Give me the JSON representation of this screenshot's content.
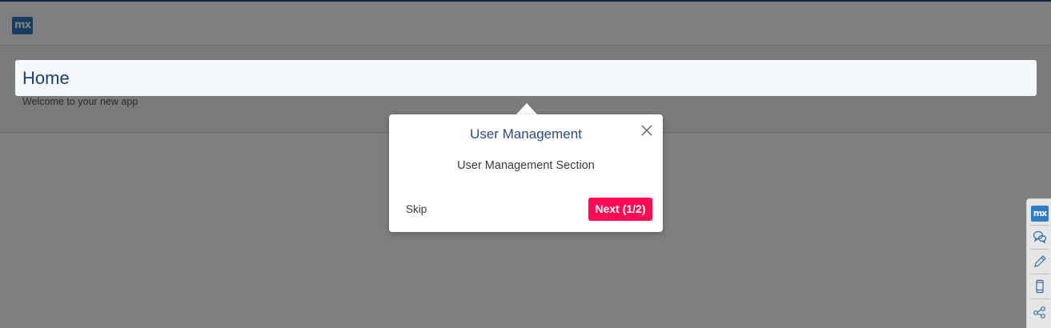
{
  "topbar": {
    "logo_text": "mx",
    "logo_color": "#2d7cc4"
  },
  "page": {
    "title": "Home",
    "subtitle": "Welcome to your new app"
  },
  "tour_popover": {
    "title": "User Management",
    "body": "User Management Section",
    "skip_label": "Skip",
    "next_label": "Next (1/2)",
    "close_icon": "close-icon",
    "next_color": "#ff0a53",
    "title_color": "#2b4a86"
  },
  "side_toolbar": {
    "logo_text": "mx",
    "items": [
      {
        "icon": "feedback-chat-icon"
      },
      {
        "icon": "pencil-icon"
      },
      {
        "icon": "mobile-device-icon"
      },
      {
        "icon": "share-icon"
      }
    ]
  },
  "colors": {
    "overlay": "rgba(0,0,0,0.5)",
    "accent_blue": "#1c3f77"
  }
}
